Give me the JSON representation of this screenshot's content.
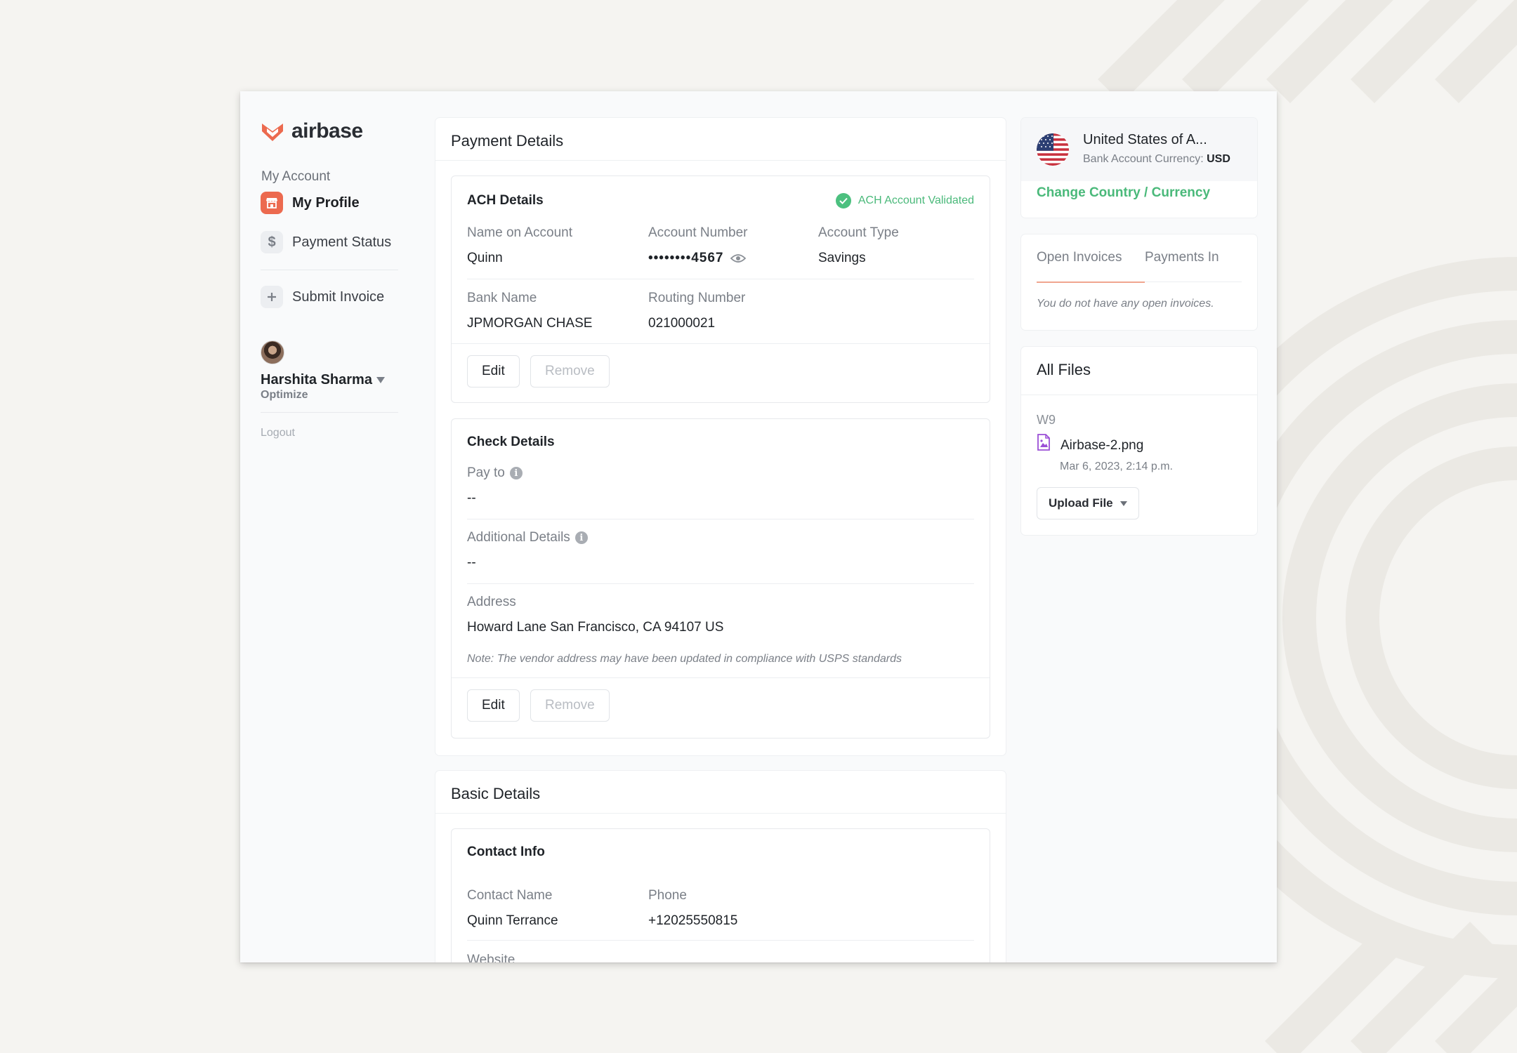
{
  "brand": {
    "name": "airbase",
    "accent": "#ec6a4f",
    "success": "#4ab97a"
  },
  "sidebar": {
    "section_label": "My Account",
    "items": [
      {
        "label": "My Profile",
        "icon": "storefront-icon",
        "active": true
      },
      {
        "label": "Payment Status",
        "icon": "dollar-icon",
        "active": false
      },
      {
        "label": "Submit Invoice",
        "icon": "plus-icon",
        "active": false
      }
    ],
    "user": {
      "name": "Harshita Sharma",
      "org": "Optimize"
    },
    "logout_label": "Logout"
  },
  "payment_details": {
    "title": "Payment Details",
    "ach": {
      "title": "ACH Details",
      "status": "ACH Account Validated",
      "name_label": "Name on Account",
      "name_value": "Quinn",
      "account_label": "Account Number",
      "account_value": "••••••••4567",
      "type_label": "Account Type",
      "type_value": "Savings",
      "bank_label": "Bank Name",
      "bank_value": "JPMORGAN CHASE",
      "routing_label": "Routing Number",
      "routing_value": "021000021",
      "edit_label": "Edit",
      "remove_label": "Remove"
    },
    "check": {
      "title": "Check Details",
      "pay_to_label": "Pay to",
      "pay_to_value": "--",
      "additional_label": "Additional Details",
      "additional_value": "--",
      "address_label": "Address",
      "address_value": "Howard Lane San Francisco, CA 94107 US",
      "note": "Note: The vendor address may have been updated in compliance with USPS standards",
      "edit_label": "Edit",
      "remove_label": "Remove"
    }
  },
  "basic_details": {
    "title": "Basic Details",
    "contact": {
      "title": "Contact Info",
      "name_label": "Contact Name",
      "name_value": "Quinn Terrance",
      "phone_label": "Phone",
      "phone_value": "+12025550815",
      "website_label": "Website"
    }
  },
  "country": {
    "name": "United States of A...",
    "currency_label": "Bank Account Currency:",
    "currency_value": "USD",
    "change_label": "Change Country / Currency"
  },
  "invoices": {
    "tabs": [
      "Open Invoices",
      "Payments In"
    ],
    "empty_message": "You do not have any open invoices."
  },
  "files": {
    "title": "All Files",
    "group": "W9",
    "file_name": "Airbase-2.png",
    "file_date": "Mar 6, 2023, 2:14 p.m.",
    "upload_label": "Upload File"
  }
}
